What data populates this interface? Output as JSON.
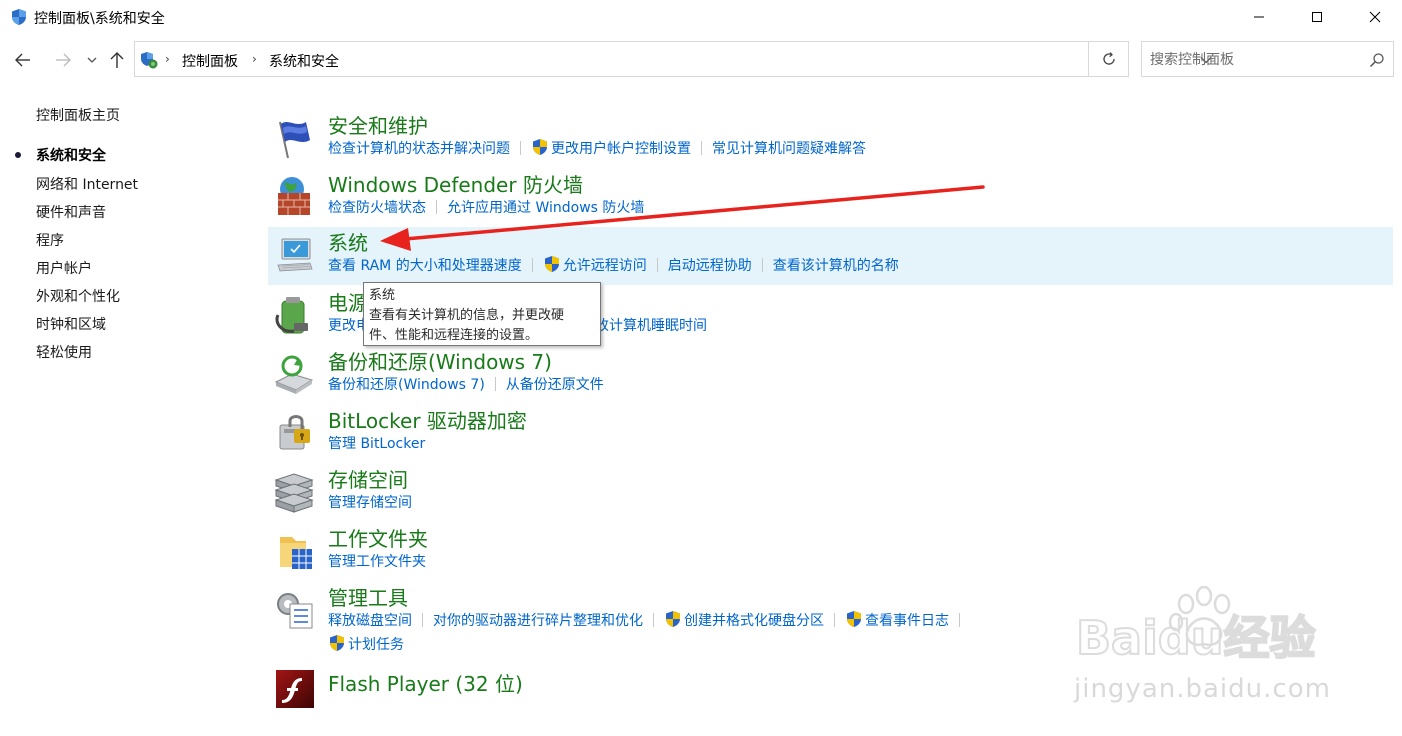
{
  "window": {
    "title": "控制面板\\系统和安全",
    "minimize_icon": "minimize-icon",
    "maximize_icon": "maximize-icon",
    "close_icon": "close-icon"
  },
  "nav": {
    "breadcrumbs": [
      "控制面板",
      "系统和安全"
    ],
    "search_placeholder": "搜索控制面板"
  },
  "sidebar": {
    "items": [
      {
        "label": "控制面板主页",
        "active": false
      },
      {
        "label": "系统和安全",
        "active": true
      },
      {
        "label": "网络和 Internet",
        "active": false
      },
      {
        "label": "硬件和声音",
        "active": false
      },
      {
        "label": "程序",
        "active": false
      },
      {
        "label": "用户帐户",
        "active": false
      },
      {
        "label": "外观和个性化",
        "active": false
      },
      {
        "label": "时钟和区域",
        "active": false
      },
      {
        "label": "轻松使用",
        "active": false
      }
    ]
  },
  "categories": [
    {
      "title": "安全和维护",
      "icon": "flag-icon",
      "links": [
        "检查计算机的状态并解决问题",
        "更改用户帐户控制设置",
        "常见计算机问题疑难解答"
      ]
    },
    {
      "title": "Windows Defender 防火墙",
      "icon": "firewall-icon",
      "links": [
        "检查防火墙状态",
        "允许应用通过 Windows 防火墙"
      ]
    },
    {
      "title": "系统",
      "icon": "computer-icon",
      "links": [
        "查看 RAM 的大小和处理器速度",
        "允许远程访问",
        "启动远程协助",
        "查看该计算机的名称"
      ]
    },
    {
      "title": "电源",
      "icon": "power-icon",
      "links": [
        "更改电",
        "更改计算机睡眠时间"
      ]
    },
    {
      "title": "备份和还原(Windows 7)",
      "icon": "backup-icon",
      "links": [
        "备份和还原(Windows 7)",
        "从备份还原文件"
      ]
    },
    {
      "title": "BitLocker 驱动器加密",
      "icon": "bitlocker-icon",
      "links": [
        "管理 BitLocker"
      ]
    },
    {
      "title": "存储空间",
      "icon": "storage-icon",
      "links": [
        "管理存储空间"
      ]
    },
    {
      "title": "工作文件夹",
      "icon": "work-folder-icon",
      "links": [
        "管理工作文件夹"
      ]
    },
    {
      "title": "管理工具",
      "icon": "admin-tools-icon",
      "links": [
        "释放磁盘空间",
        "对你的驱动器进行碎片整理和优化",
        "创建并格式化硬盘分区",
        "查看事件日志",
        "计划任务"
      ]
    },
    {
      "title": "Flash Player (32 位)",
      "icon": "flash-icon",
      "links": []
    }
  ],
  "tooltip": {
    "title": "系统",
    "desc_line1": "查看有关计算机的信息，并更改硬",
    "desc_line2": "件、性能和远程连接的设置。"
  },
  "watermark": {
    "brand": "Baidu经验",
    "url": "jingyan.baidu.com"
  },
  "colors": {
    "title_green": "#197a19",
    "link_blue": "#0066cc",
    "hover_bg": "#e5f3fb",
    "arrow_red": "#e8231e"
  }
}
